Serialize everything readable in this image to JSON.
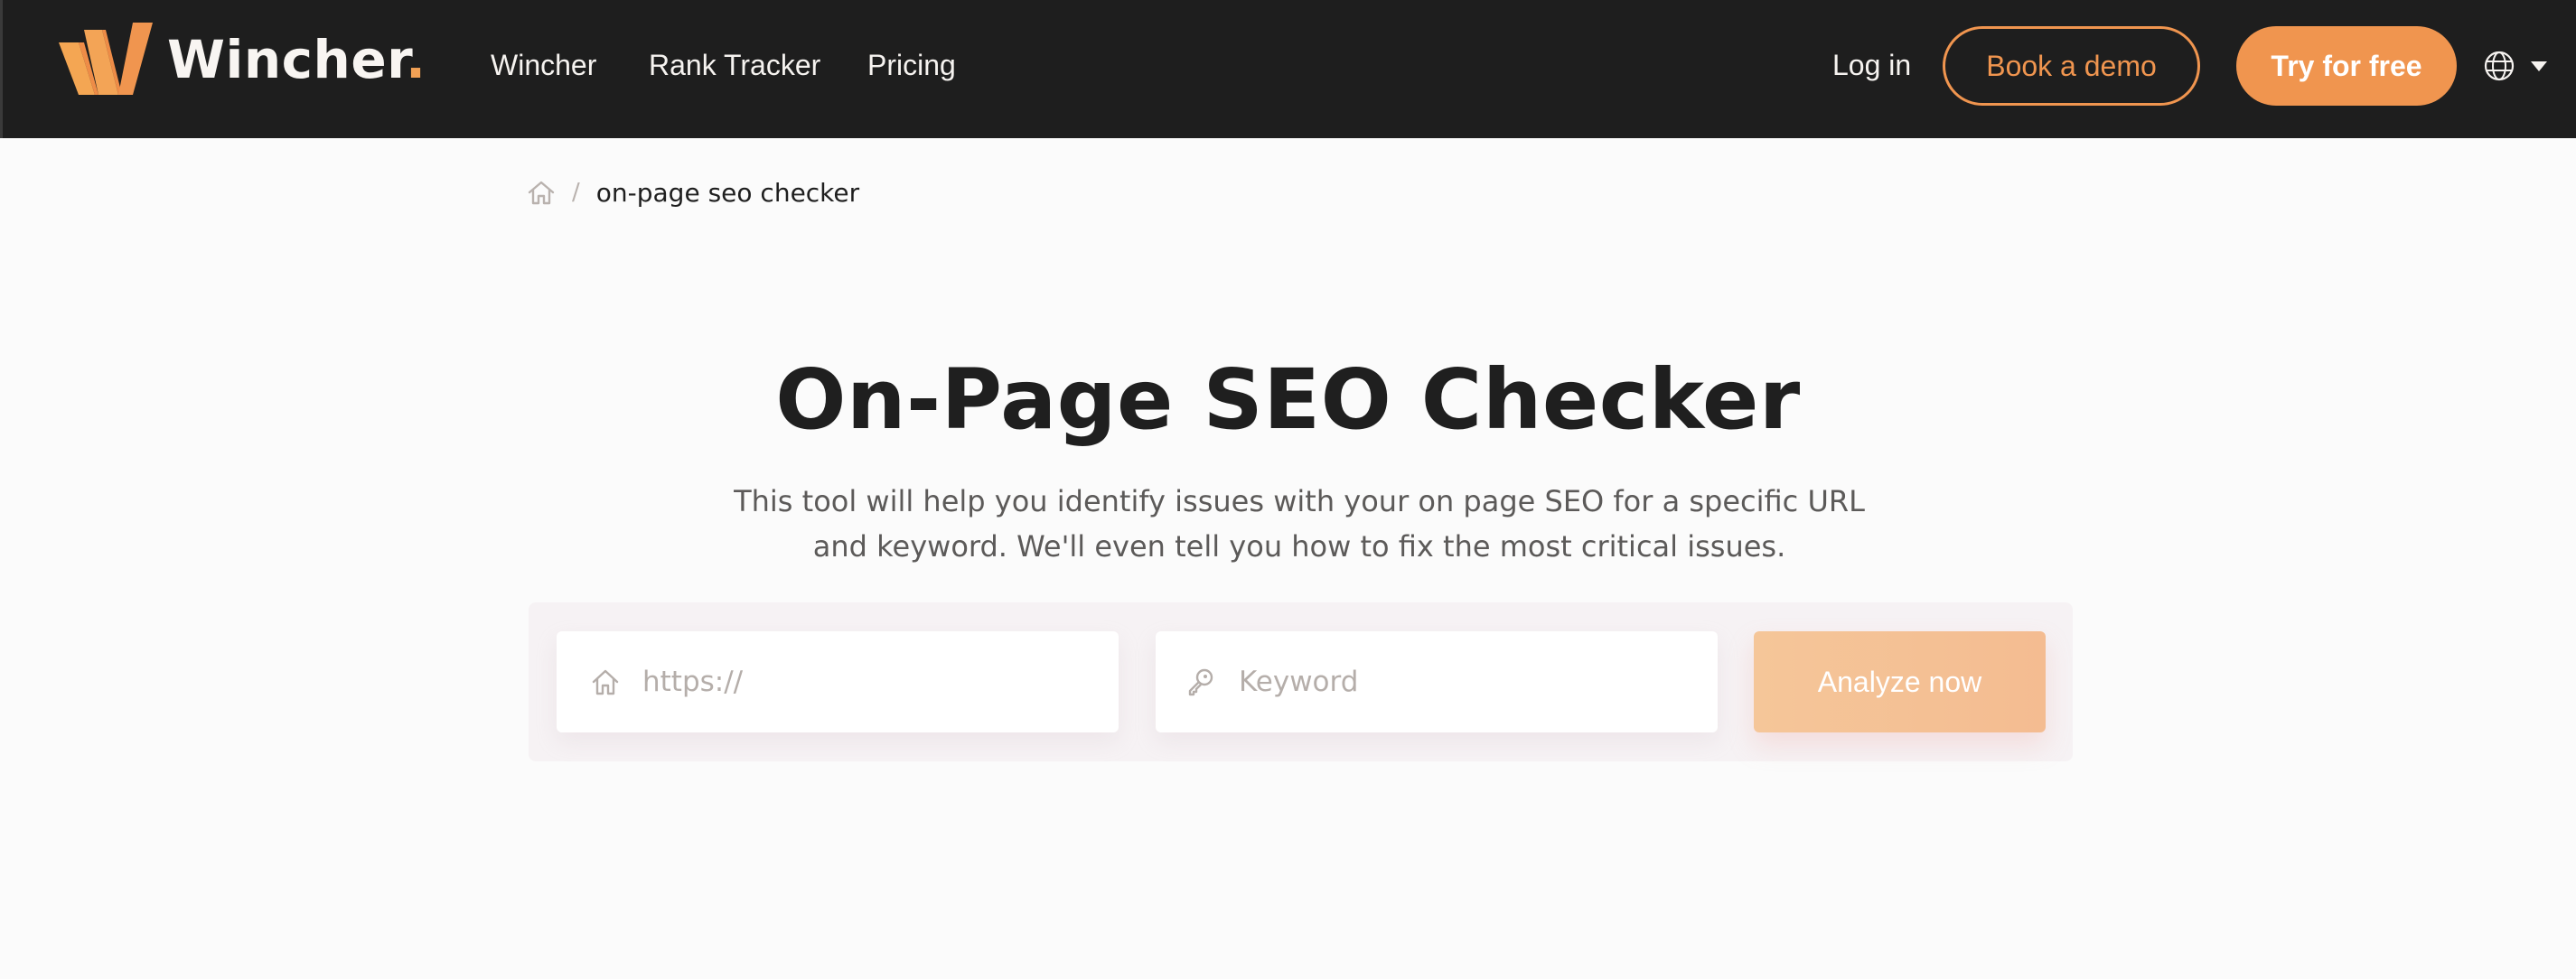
{
  "header": {
    "logo_text": "Wincher",
    "logo_dot": ".",
    "nav": [
      {
        "label": "Wincher"
      },
      {
        "label": "Rank Tracker"
      },
      {
        "label": "Pricing"
      }
    ],
    "login_label": "Log in",
    "book_demo_label": "Book a demo",
    "try_free_label": "Try for free",
    "language_icon": "globe-icon"
  },
  "breadcrumb": {
    "home_icon": "home-icon",
    "separator": "/",
    "current": "on-page seo checker"
  },
  "main": {
    "title": "On-Page SEO Checker",
    "subtitle": "This tool will help you identify issues with your on page SEO for a specific URL and keyword. We'll even tell you how to fix the most critical issues.",
    "form": {
      "url_placeholder": "https://",
      "url_value": "",
      "url_icon": "home-icon",
      "keyword_placeholder": "Keyword",
      "keyword_value": "",
      "keyword_icon": "key-icon",
      "submit_label": "Analyze now"
    }
  },
  "colors": {
    "brand_orange": "#f0954f",
    "header_bg": "#1e1e1e",
    "page_bg": "#fbfbfb",
    "analyze_button": "#f5c497",
    "heading_text": "#1f1f1f",
    "placeholder_text": "#b5aeaa"
  }
}
